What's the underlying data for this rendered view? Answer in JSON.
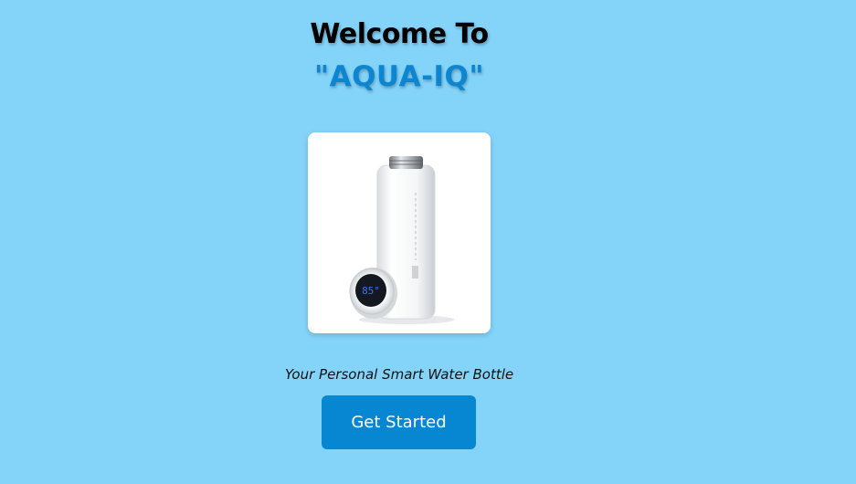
{
  "welcome": {
    "line1": "Welcome To",
    "line2": "\"AQUA-IQ\""
  },
  "product": {
    "image_description": "smart-water-bottle-image",
    "lid_display_temp": "85°"
  },
  "tagline": "Your Personal Smart Water Bottle",
  "cta": {
    "label": "Get Started"
  },
  "colors": {
    "background": "#84d4fa",
    "brand_blue": "#0d85d0",
    "button": "#0787d2"
  }
}
